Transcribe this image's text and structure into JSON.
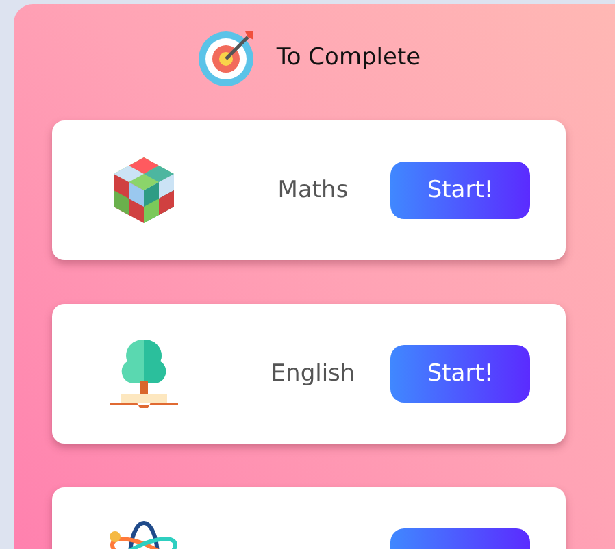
{
  "header": {
    "title": "To Complete"
  },
  "subjects": [
    {
      "kind": "cube",
      "name": "Maths",
      "button": "Start!"
    },
    {
      "kind": "tree",
      "name": "English",
      "button": "Start!"
    },
    {
      "kind": "atom"
    }
  ]
}
